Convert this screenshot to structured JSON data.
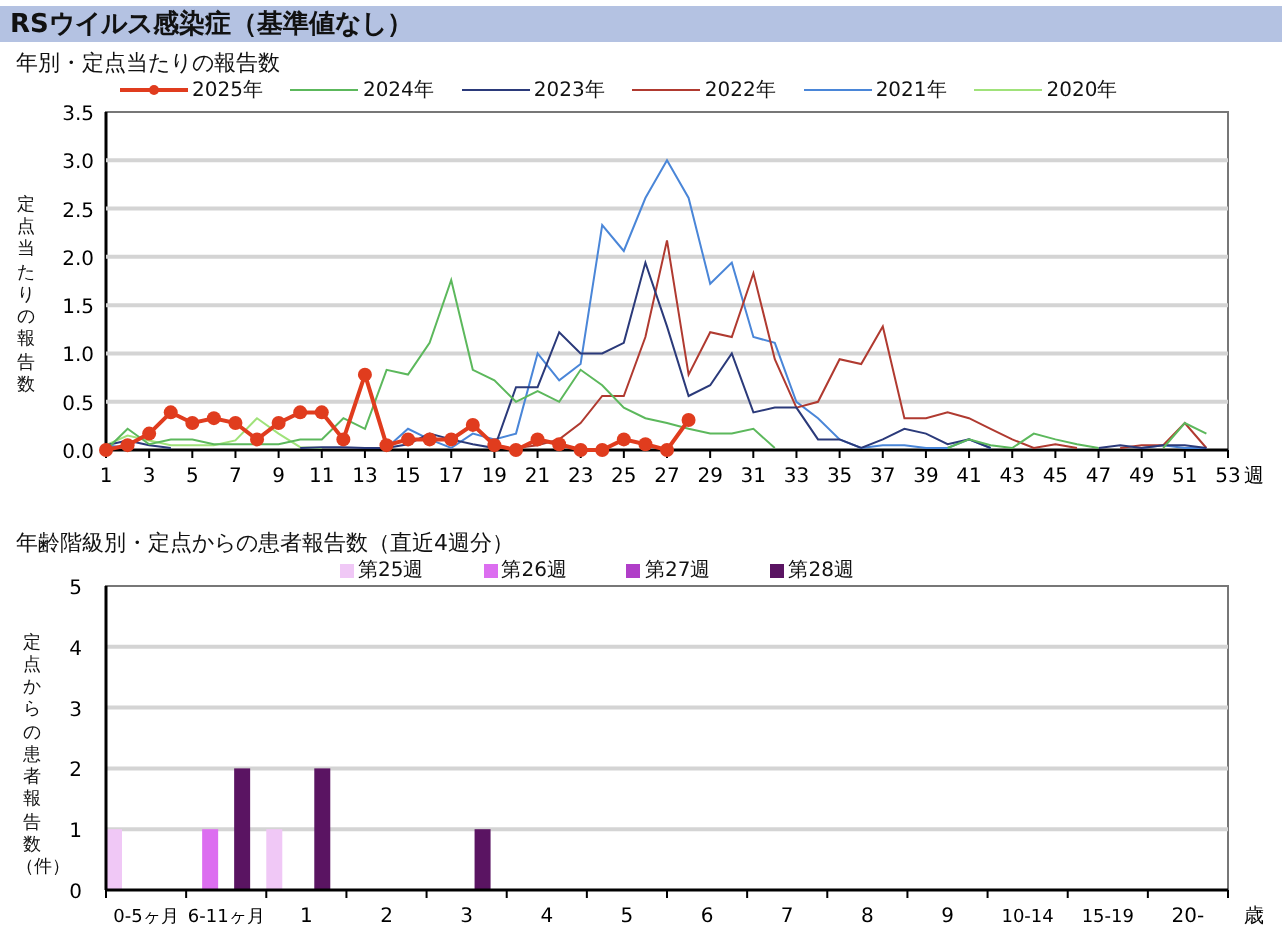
{
  "header": {
    "title": "RSウイルス感染症（基準値なし）"
  },
  "weekly": {
    "chart_data": {
      "type": "line",
      "title": "年別・定点当たりの報告数",
      "ylabel": "定点当たりの報告数",
      "xlabel": "週",
      "xlim": [
        1,
        53
      ],
      "ylim": [
        0,
        3.5
      ],
      "xticks": [
        1,
        3,
        5,
        7,
        9,
        11,
        13,
        15,
        17,
        19,
        21,
        23,
        25,
        27,
        29,
        31,
        33,
        35,
        37,
        39,
        41,
        43,
        45,
        47,
        49,
        51,
        53
      ],
      "yticks": [
        {
          "value": 0,
          "label": "0.0"
        },
        {
          "value": 0.5,
          "label": "0.5"
        },
        {
          "value": 1,
          "label": "1.0"
        },
        {
          "value": 1.5,
          "label": "1.5"
        },
        {
          "value": 2,
          "label": "2.0"
        },
        {
          "value": 2.5,
          "label": "2.5"
        },
        {
          "value": 3,
          "label": "3.0"
        },
        {
          "value": 3.5,
          "label": "3.5"
        }
      ],
      "grid": true,
      "x": [
        1,
        2,
        3,
        4,
        5,
        6,
        7,
        8,
        9,
        10,
        11,
        12,
        13,
        14,
        15,
        16,
        17,
        18,
        19,
        20,
        21,
        22,
        23,
        24,
        25,
        26,
        27,
        28,
        29,
        30,
        31,
        32,
        33,
        34,
        35,
        36,
        37,
        38,
        39,
        40,
        41,
        42,
        43,
        44,
        45,
        46,
        47,
        48,
        49,
        50,
        51,
        52
      ],
      "series": [
        {
          "name": "2025年",
          "color": "#e03c1e",
          "marker": "o",
          "values": [
            0,
            0.05,
            0.17,
            0.39,
            0.28,
            0.33,
            0.28,
            0.11,
            0.28,
            0.39,
            0.39,
            0.11,
            0.78,
            0.05,
            0.11,
            0.11,
            0.11,
            0.26,
            0.05,
            0,
            0.11,
            0.06,
            0,
            0,
            0.11,
            0.06,
            0,
            0.31,
            null,
            null,
            null,
            null,
            null,
            null,
            null,
            null,
            null,
            null,
            null,
            null,
            null,
            null,
            null,
            null,
            null,
            null,
            null,
            null,
            null,
            null,
            null,
            null
          ]
        },
        {
          "name": "2024年",
          "color": "#5cb85c",
          "values": [
            0,
            0.22,
            0.06,
            0.11,
            0.11,
            0.06,
            0.06,
            0.06,
            0.06,
            0.11,
            0.11,
            0.33,
            0.22,
            0.83,
            0.78,
            1.11,
            1.76,
            0.83,
            0.72,
            0.5,
            0.61,
            0.5,
            0.83,
            0.67,
            0.44,
            0.33,
            0.28,
            0.22,
            0.17,
            0.17,
            0.22,
            0.02,
            null,
            null,
            null,
            null,
            null,
            null,
            null,
            0.02,
            0.11,
            0.05,
            0.02,
            0.17,
            0.11,
            0.06,
            0.02,
            null,
            null,
            0.02,
            0.28,
            0.17
          ]
        },
        {
          "name": "2023年",
          "color": "#2b3a7a",
          "values": [
            0.05,
            0.1,
            0.05,
            0.02,
            null,
            null,
            null,
            null,
            null,
            0.02,
            0.03,
            0.03,
            0.02,
            0.02,
            0.06,
            0.17,
            0.11,
            0.06,
            0.02,
            0.65,
            0.65,
            1.22,
            1,
            1,
            1.11,
            1.94,
            1.28,
            0.56,
            0.67,
            1,
            0.39,
            0.44,
            0.44,
            0.11,
            0.11,
            0.02,
            0.11,
            0.22,
            0.17,
            0.06,
            0.11,
            0.02,
            null,
            null,
            null,
            null,
            0.02,
            0.05,
            0.02,
            0.05,
            0.05,
            0.02
          ]
        },
        {
          "name": "2022年",
          "color": "#b03a30",
          "values": [
            null,
            null,
            null,
            null,
            null,
            null,
            null,
            null,
            null,
            null,
            null,
            null,
            null,
            null,
            null,
            null,
            null,
            null,
            null,
            0.02,
            0.05,
            0.11,
            0.28,
            0.56,
            0.56,
            1.17,
            2.17,
            0.78,
            1.22,
            1.17,
            1.83,
            0.94,
            0.44,
            0.5,
            0.94,
            0.89,
            1.28,
            0.33,
            0.33,
            0.39,
            0.33,
            0.22,
            0.11,
            0.02,
            0.06,
            0.02,
            null,
            0.02,
            0.05,
            0.05,
            0.28,
            0.02
          ]
        },
        {
          "name": "2021年",
          "color": "#4a86d8",
          "values": [
            0.05,
            0.02,
            null,
            null,
            null,
            null,
            null,
            null,
            null,
            null,
            null,
            null,
            null,
            0.02,
            0.22,
            0.11,
            0.02,
            0.17,
            0.11,
            0.17,
            1,
            0.72,
            0.89,
            2.33,
            2.06,
            2.61,
            3,
            2.61,
            1.72,
            1.94,
            1.17,
            1.11,
            0.5,
            0.33,
            0.11,
            0.02,
            0.05,
            0.05,
            0.02,
            0.02,
            0.11,
            0.02,
            null,
            null,
            null,
            null,
            null,
            null,
            0.02,
            0.05,
            0.02,
            0.02
          ]
        },
        {
          "name": "2020年",
          "color": "#a0e27a",
          "values": [
            0.05,
            0.15,
            0.1,
            0.05,
            0.05,
            0.05,
            0.1,
            0.33,
            0.17,
            0.03,
            0.02,
            null,
            null,
            null,
            null,
            null,
            null,
            null,
            null,
            null,
            null,
            null,
            null,
            null,
            null,
            null,
            null,
            null,
            null,
            null,
            null,
            null,
            null,
            null,
            null,
            null,
            null,
            null,
            null,
            null,
            null,
            null,
            null,
            null,
            null,
            null,
            null,
            null,
            null,
            null,
            null,
            null
          ]
        }
      ]
    }
  },
  "age": {
    "chart_data": {
      "type": "bar",
      "title": "年齢階級別・定点からの患者報告数（直近4週分）",
      "ylabel": "定点からの患者報告数（件）",
      "xlabel": "歳",
      "ylim": [
        0,
        5
      ],
      "grid": true,
      "yticks": [
        {
          "value": 0,
          "label": "0"
        },
        {
          "value": 1,
          "label": "1"
        },
        {
          "value": 2,
          "label": "2"
        },
        {
          "value": 3,
          "label": "3"
        },
        {
          "value": 4,
          "label": "4"
        },
        {
          "value": 5,
          "label": "5"
        }
      ],
      "categories": [
        "0-5ヶ月",
        "6-11ヶ月",
        "1",
        "2",
        "3",
        "4",
        "5",
        "6",
        "7",
        "8",
        "9",
        "10-14",
        "15-19",
        "20-"
      ],
      "series": [
        {
          "name": "第25週",
          "color": "#f0c8f6",
          "values": [
            1,
            0,
            1,
            0,
            0,
            0,
            0,
            0,
            0,
            0,
            0,
            0,
            0,
            0
          ]
        },
        {
          "name": "第26週",
          "color": "#dc6ef0",
          "values": [
            0,
            1,
            0,
            0,
            0,
            0,
            0,
            0,
            0,
            0,
            0,
            0,
            0,
            0
          ]
        },
        {
          "name": "第27週",
          "color": "#b03ec8",
          "values": [
            0,
            0,
            0,
            0,
            0,
            0,
            0,
            0,
            0,
            0,
            0,
            0,
            0,
            0
          ]
        },
        {
          "name": "第28週",
          "color": "#5a1462",
          "values": [
            0,
            2,
            2,
            0,
            1,
            0,
            0,
            0,
            0,
            0,
            0,
            0,
            0,
            0
          ]
        }
      ]
    }
  }
}
